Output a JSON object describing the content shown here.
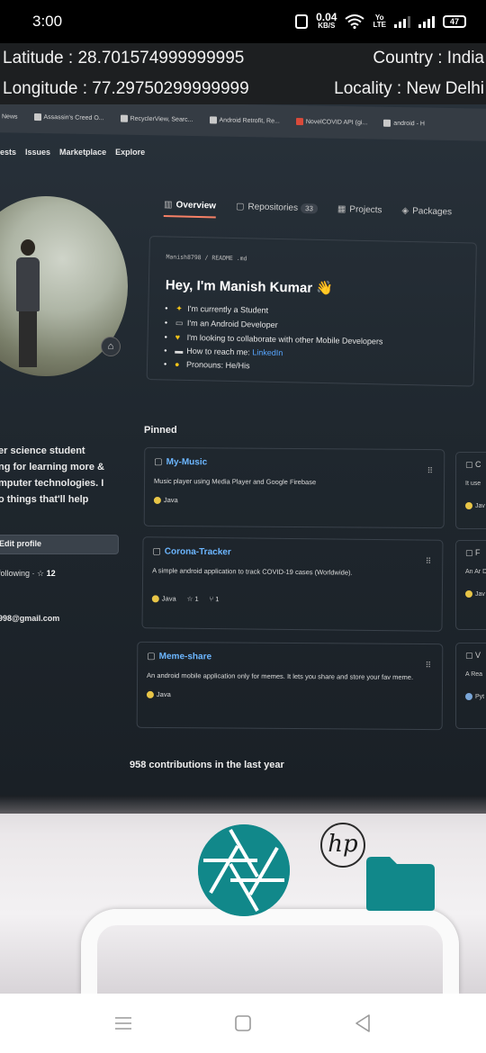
{
  "status_bar": {
    "time": "3:00",
    "net_speed_value": "0.04",
    "net_speed_unit": "KB/S",
    "volte_top": "Yo",
    "volte_bottom": "LTE",
    "battery": "47"
  },
  "location": {
    "latitude_text": "Latitude : 28.701574999999995",
    "longitude_text": "Longitude : 77.29750299999999",
    "country_text": "Country : India",
    "locality_text": "Locality : New Delhi"
  },
  "camera_view": {
    "bookmarks": [
      "News",
      "Assassin's Creed O...",
      "RecyclerView, Searc...",
      "Android Retrofit, Re...",
      "NovelCOVID API (gi...",
      "android - H"
    ],
    "github_nav": [
      "ests",
      "Issues",
      "Marketplace",
      "Explore"
    ],
    "tabs": [
      {
        "label": "Overview",
        "icon": "book-icon"
      },
      {
        "label": "Repositories",
        "count": "33",
        "icon": "repo-icon"
      },
      {
        "label": "Projects",
        "icon": "project-icon"
      },
      {
        "label": "Packages",
        "icon": "package-icon"
      }
    ],
    "readme": {
      "path": "Manish8798 / README .md",
      "title": "Hey, I'm Manish Kumar 👋",
      "items": [
        {
          "text": "I'm currently a Student"
        },
        {
          "text": "I'm an Android Developer"
        },
        {
          "text": "I'm looking to collaborate with other Mobile Developers"
        },
        {
          "text": "How to reach me: ",
          "link": "LinkedIn"
        },
        {
          "text": "Pronouns: He/His"
        }
      ]
    },
    "bio_lines": [
      "er science student",
      "ng for learning more &",
      "mputer technologies. I",
      "o things that'll help"
    ],
    "edit_profile": "Edit profile",
    "follow_text": "following · ☆",
    "follow_count": "12",
    "email": "998@gmail.com",
    "pinned_label": "Pinned",
    "pinned": [
      {
        "name": "My-Music",
        "desc": "Music player using Media Player and Google Firebase",
        "lang": "Java",
        "stars": "",
        "forks": ""
      },
      {
        "name": "Corona-Tracker",
        "desc": "A simple android application to track COVID-19 cases (Worldwide).",
        "lang": "Java",
        "stars": "1",
        "forks": "1"
      },
      {
        "name": "Meme-share",
        "desc": "An android mobile application only for memes. It lets you share and store your fav meme.",
        "lang": "Java",
        "stars": "",
        "forks": ""
      }
    ],
    "side_cards": [
      {
        "title": "C",
        "text": "It use",
        "lang": "Jav"
      },
      {
        "title": "F",
        "text": "An Ar Datab",
        "lang": "Jav"
      },
      {
        "title": "V",
        "text": "A Rea",
        "lang": "Pyt"
      }
    ],
    "contributions": "958 contributions in the last year",
    "monitor_brand": "hp"
  },
  "controls": {
    "shutter_color": "#11888a",
    "folder_color": "#11888a"
  },
  "colors": {
    "accent_teal": "#11888a",
    "link_blue": "#58a6ff",
    "java_dot": "#e8c547"
  }
}
